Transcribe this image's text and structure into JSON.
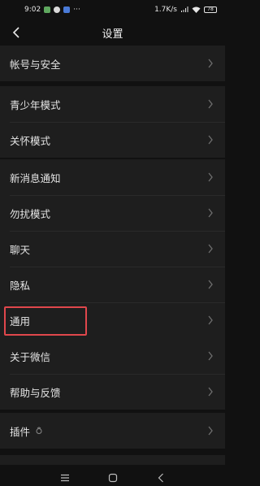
{
  "status_bar": {
    "time": "9:02",
    "dots": "···",
    "network_speed": "1.7K/s",
    "battery": "78"
  },
  "header": {
    "title": "设置"
  },
  "groups": [
    {
      "items": [
        {
          "label": "帐号与安全"
        }
      ]
    },
    {
      "items": [
        {
          "label": "青少年模式"
        },
        {
          "label": "关怀模式"
        }
      ]
    },
    {
      "items": [
        {
          "label": "新消息通知"
        },
        {
          "label": "勿扰模式"
        },
        {
          "label": "聊天"
        },
        {
          "label": "隐私"
        },
        {
          "label": "通用"
        }
      ]
    },
    {
      "items": [
        {
          "label": "关于微信"
        },
        {
          "label": "帮助与反馈"
        }
      ]
    },
    {
      "items": [
        {
          "label": "插件"
        }
      ]
    }
  ],
  "annotation": {
    "color": "#e0474c",
    "target": "通用"
  },
  "colors": {
    "background": "#111111",
    "row_background": "#1e1e1e",
    "text": "#e4e4e4"
  },
  "icons": {
    "back": "chevron-left-icon",
    "row": "chevron-right-icon",
    "plugin": "plugin-icon"
  }
}
